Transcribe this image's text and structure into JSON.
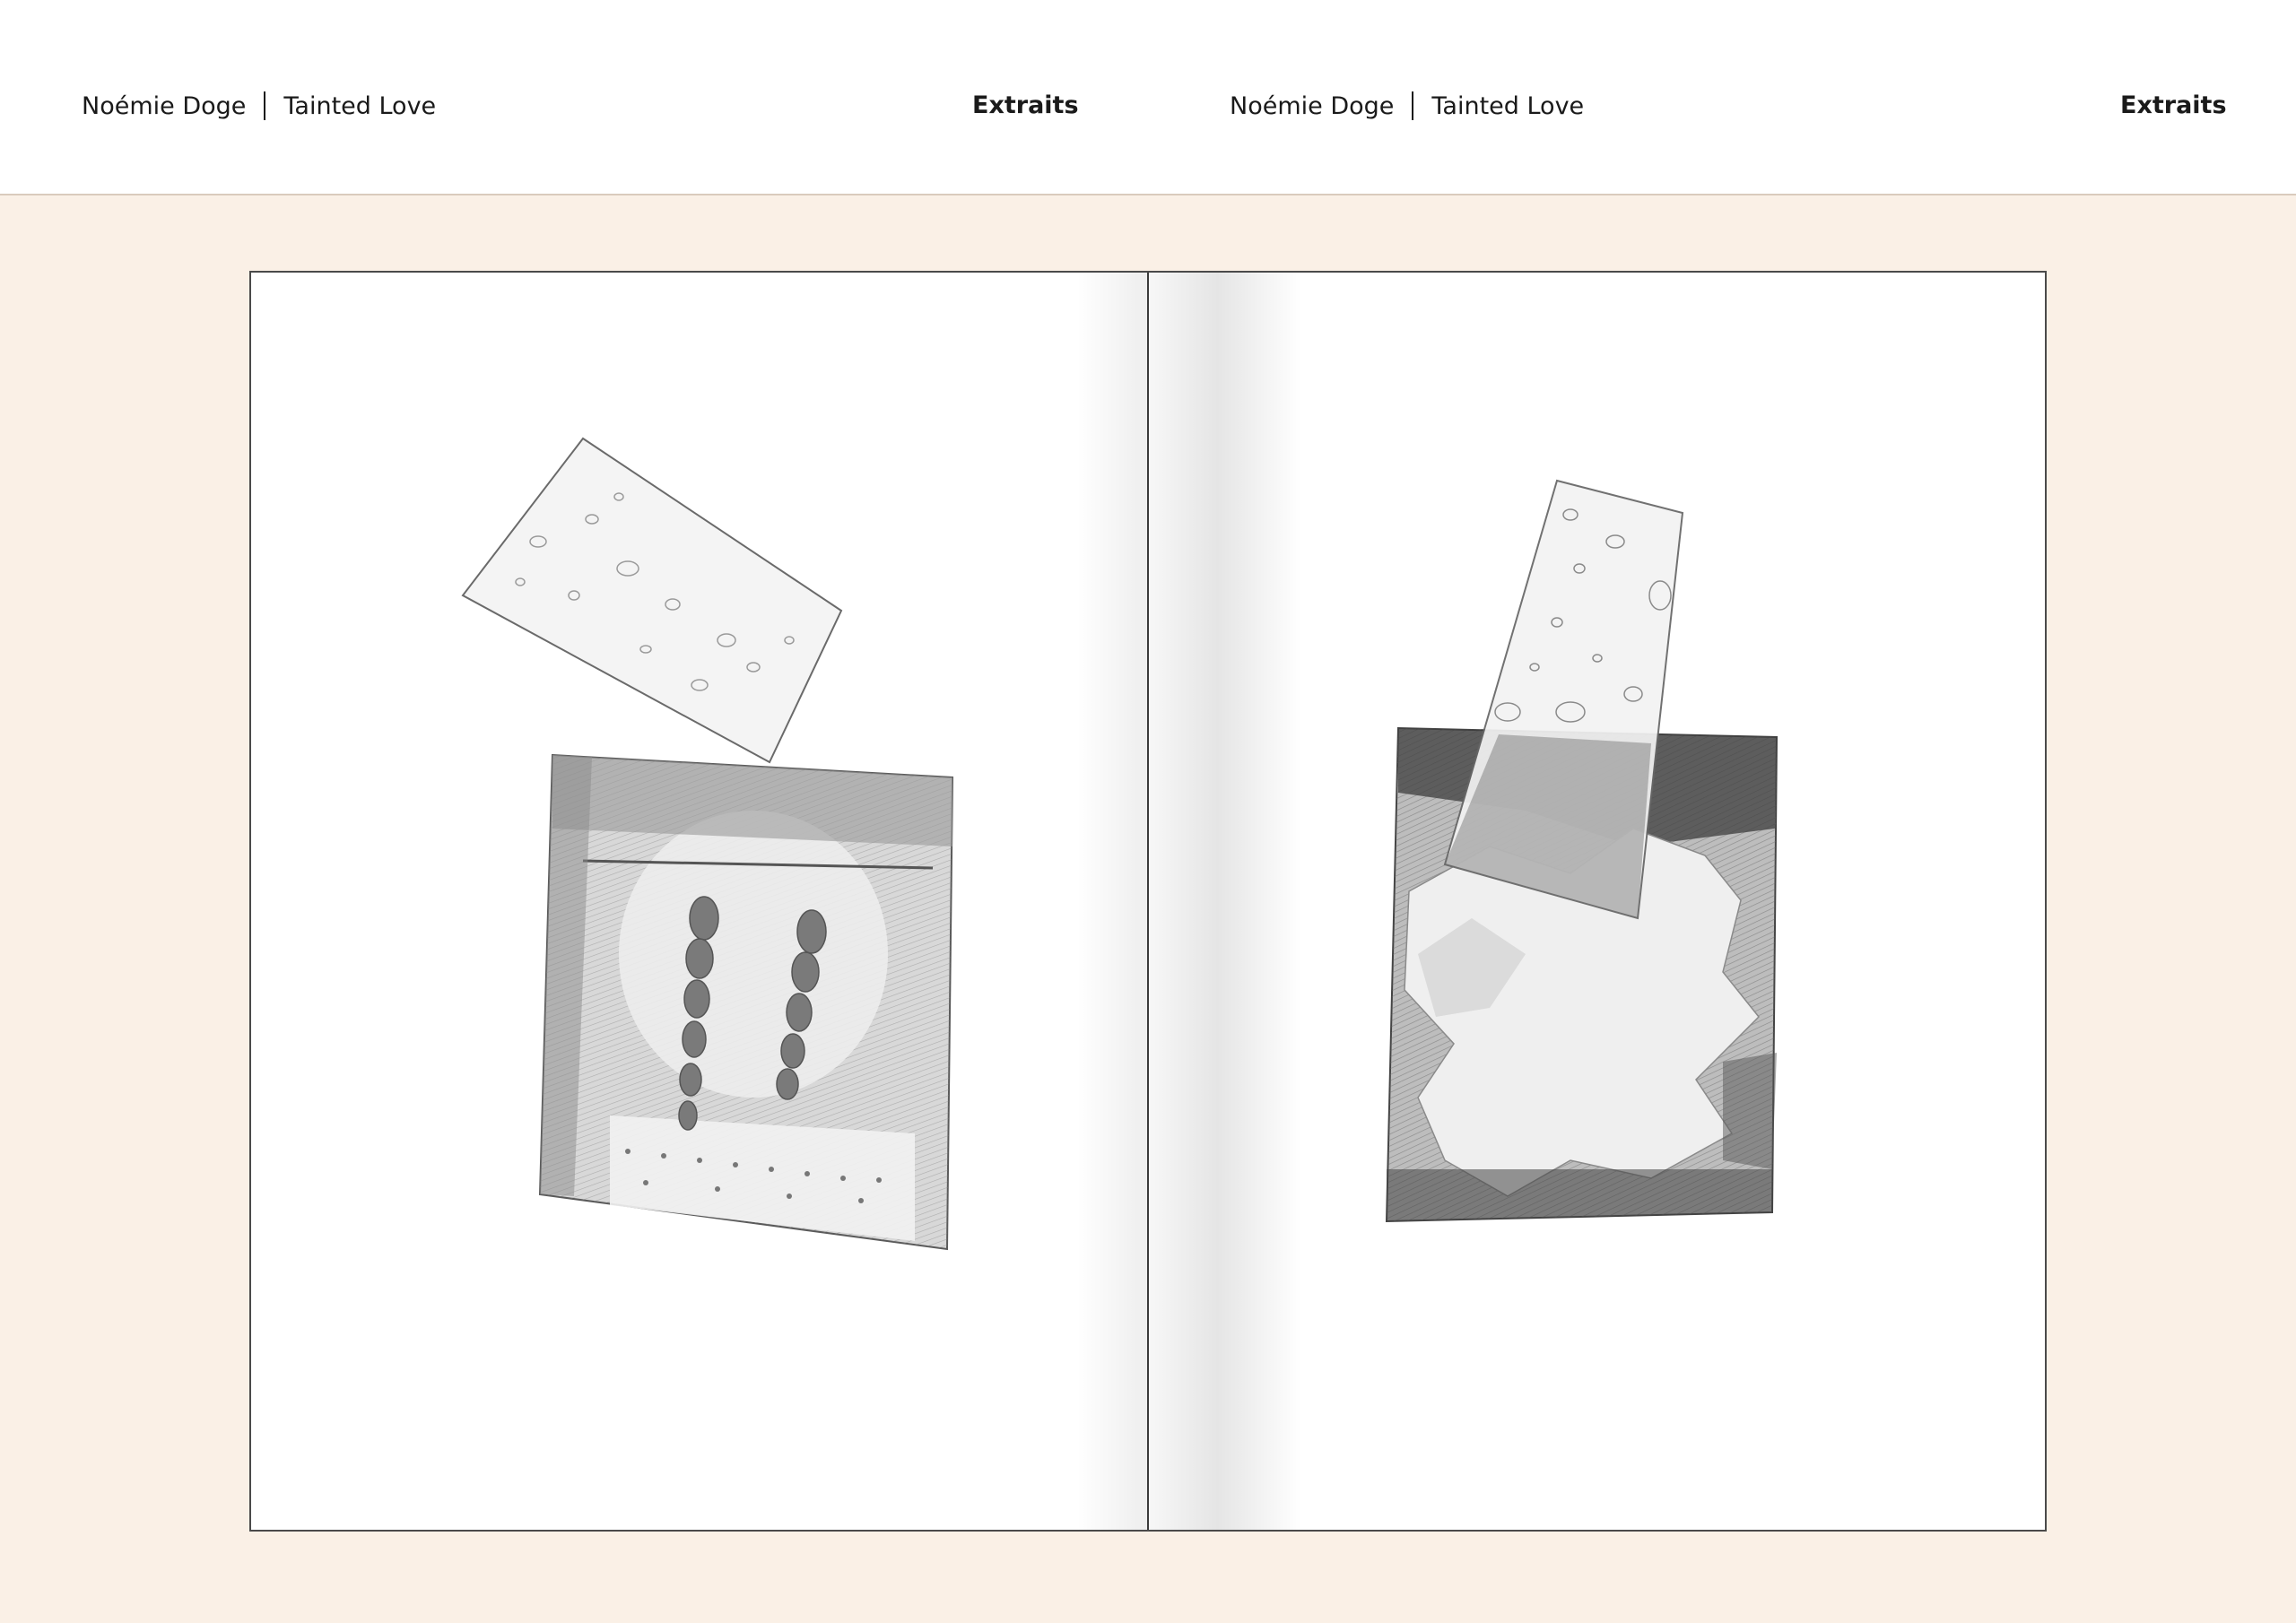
{
  "header": {
    "left": {
      "author": "Noémie Doge",
      "title": "Tainted Love",
      "section": "Extraits"
    },
    "right": {
      "author": "Noémie Doge",
      "title": "Tainted Love",
      "section": "Extraits"
    }
  },
  "colors": {
    "background": "#faf0e6",
    "header_background": "#ffffff",
    "divider": "#d9cbbd",
    "spread_border": "#4a4a4a",
    "text": "#1a1a1a"
  },
  "spread": {
    "left_page": {
      "illustration": "pencil-drawing-braids"
    },
    "right_page": {
      "illustration": "pencil-drawing-abstract"
    }
  }
}
